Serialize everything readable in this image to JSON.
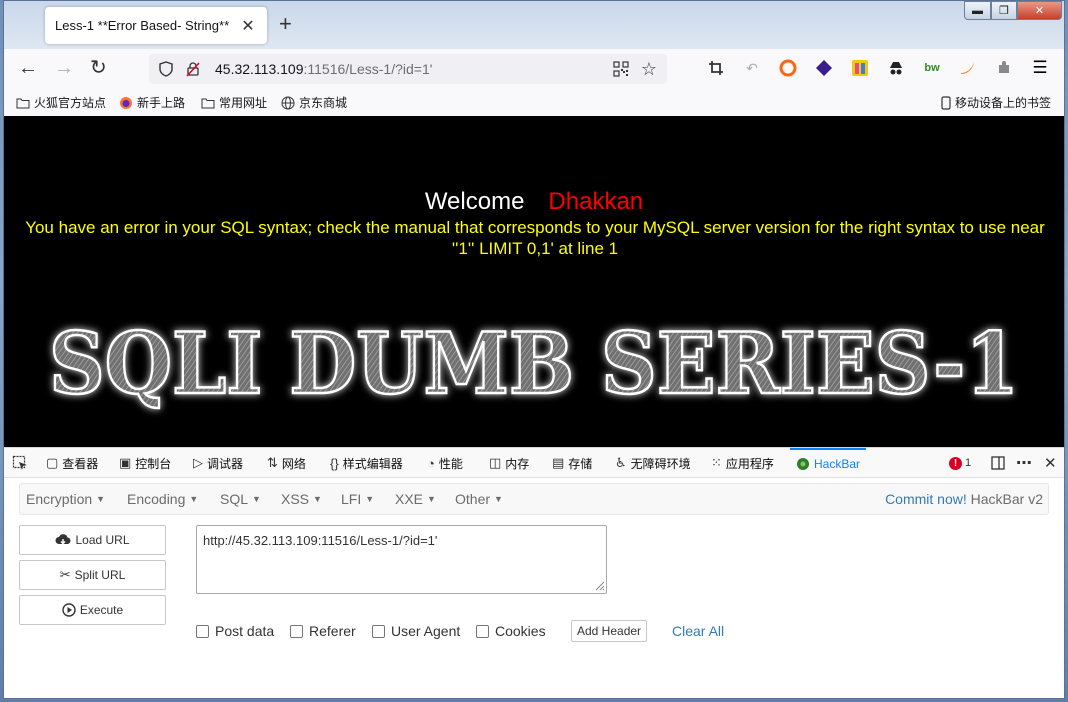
{
  "browser": {
    "tab": {
      "title": "Less-1 **Error Based- String**",
      "close": "✕"
    },
    "new_tab": "+",
    "window_controls": {
      "minimize": "▬",
      "maximize": "❐",
      "close": "✕"
    },
    "nav": {
      "back": "←",
      "forward": "→",
      "reload": "↻"
    },
    "url": {
      "host": "45.32.113.109",
      "rest": ":11516/Less-1/?id=1'"
    },
    "menu": "☰",
    "bookmarks": [
      {
        "label": "火狐官方站点",
        "icon": "folder-icon"
      },
      {
        "label": "新手上路",
        "icon": "firefox-icon"
      },
      {
        "label": "常用网址",
        "icon": "folder-icon"
      },
      {
        "label": "京东商城",
        "icon": "globe-icon"
      }
    ],
    "mobile_bookmarks": "移动设备上的书签"
  },
  "page": {
    "welcome": "Welcome",
    "name": "Dhakkan",
    "error_line1": "You have an error in your SQL syntax; check the manual that corresponds to your MySQL server version for the right syntax to use near",
    "error_line2": "''1'' LIMIT 0,1' at line 1",
    "banner": "SQLI DUMB SERIES-1"
  },
  "devtools": {
    "tabs": [
      {
        "label": "查看器",
        "icon": "inspector-icon"
      },
      {
        "label": "控制台",
        "icon": "console-icon"
      },
      {
        "label": "调试器",
        "icon": "debugger-icon"
      },
      {
        "label": "网络",
        "icon": "network-icon"
      },
      {
        "label": "样式编辑器",
        "icon": "style-editor-icon"
      },
      {
        "label": "性能",
        "icon": "performance-icon"
      },
      {
        "label": "内存",
        "icon": "memory-icon"
      },
      {
        "label": "存储",
        "icon": "storage-icon"
      },
      {
        "label": "无障碍环境",
        "icon": "accessibility-icon"
      },
      {
        "label": "应用程序",
        "icon": "application-icon"
      },
      {
        "label": "HackBar",
        "icon": "hackbar-icon"
      }
    ],
    "error_count": "1"
  },
  "hackbar": {
    "menus": [
      "Encryption",
      "Encoding",
      "SQL",
      "XSS",
      "LFI",
      "XXE",
      "Other"
    ],
    "commit_link": "Commit now!",
    "version": "HackBar v2",
    "buttons": {
      "load": "Load URL",
      "split": "Split URL",
      "execute": "Execute"
    },
    "url_value": "http://45.32.113.109:11516/Less-1/?id=1'",
    "options": [
      "Post data",
      "Referer",
      "User Agent",
      "Cookies"
    ],
    "add_header": "Add Header",
    "clear_all": "Clear All"
  }
}
